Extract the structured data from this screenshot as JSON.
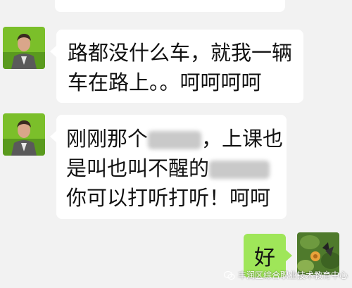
{
  "colors": {
    "background": "#f2f2f2",
    "incoming_bubble": "#ffffff",
    "outgoing_bubble": "#9fe659"
  },
  "messages": [
    {
      "sender": "other",
      "lines": [
        "路都没什么车，就我一辆",
        "车在路上。。呵呵呵呵"
      ]
    },
    {
      "sender": "other",
      "line1_start": "刚刚那个",
      "line1_end": "，上课也",
      "line2_start": "是叫也叫不醒的",
      "line3": "你可以打听打听！呵呵"
    },
    {
      "sender": "me",
      "text": "好"
    }
  ],
  "watermark": {
    "text": "丰润区综合职业技术教育中心",
    "icon": "wechat-icon"
  }
}
